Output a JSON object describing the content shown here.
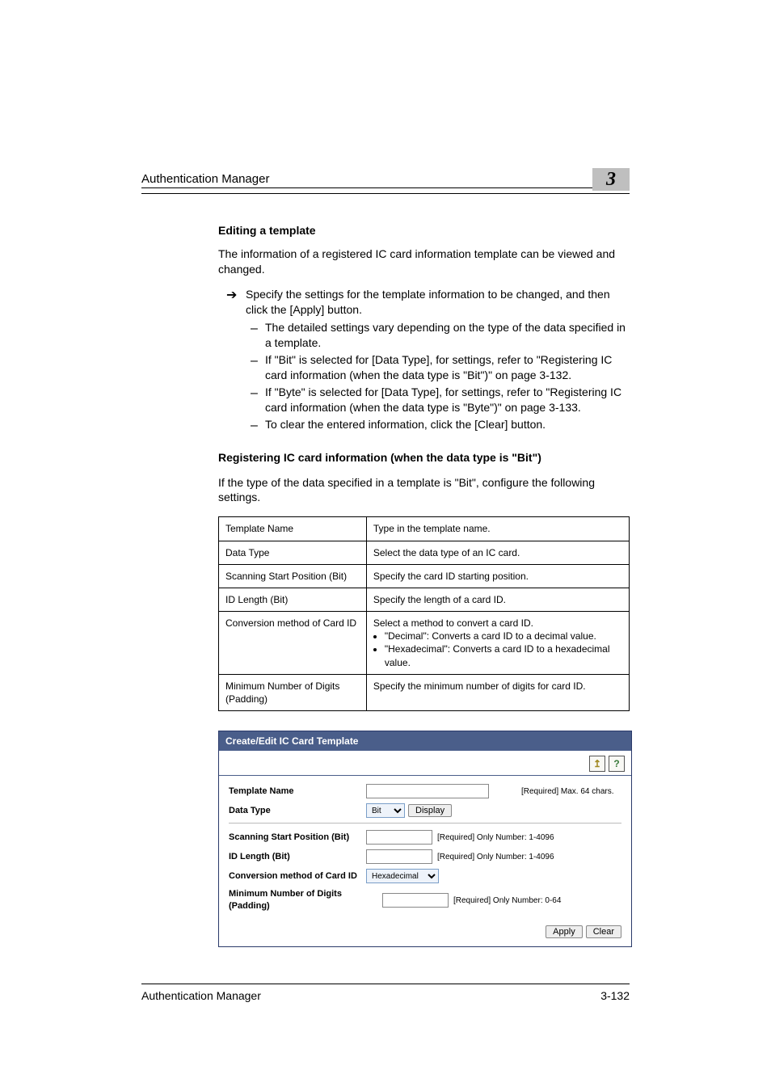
{
  "header": {
    "section": "Authentication Manager",
    "chapter": "3"
  },
  "section1": {
    "heading": "Editing a template",
    "intro": "The information of a registered IC card information template can be viewed and changed.",
    "arrow_text": "Specify the settings for the template information to be changed, and then click the [Apply] button.",
    "dashes": [
      "The detailed settings vary depending on the type of the data specified in a template.",
      "If \"Bit\" is selected for [Data Type], for settings, refer to \"Registering IC card information (when the data type is \"Bit\")\" on page 3-132.",
      "If \"Byte\" is selected for [Data Type], for settings, refer to \"Registering IC card information (when the data type is \"Byte\")\" on page 3-133.",
      "To clear the entered information, click the [Clear] button."
    ]
  },
  "section2": {
    "heading": "Registering IC card information (when the data type is \"Bit\")",
    "intro": "If the type of the data specified in a template is \"Bit\", configure the following settings."
  },
  "table": {
    "rows": [
      {
        "name": "Template Name",
        "desc": "Type in the template name."
      },
      {
        "name": "Data Type",
        "desc": "Select the data type of an IC card."
      },
      {
        "name": "Scanning Start Position (Bit)",
        "desc": "Specify the card ID starting position."
      },
      {
        "name": "ID Length (Bit)",
        "desc": "Specify the length of a card ID."
      },
      {
        "name": "Conversion method of Card ID",
        "desc": "Select a method to convert a card ID.",
        "bullets": [
          "\"Decimal\": Converts a card ID to a decimal value.",
          "\"Hexadecimal\": Converts a card ID to a hexadecimal value."
        ]
      },
      {
        "name": "Minimum Number of Digits (Padding)",
        "desc": "Specify the minimum number of digits for card ID."
      }
    ]
  },
  "fig": {
    "title": "Create/Edit IC Card Template",
    "labels": {
      "template_name": "Template Name",
      "data_type": "Data Type",
      "scan_start": "Scanning Start Position (Bit)",
      "id_length": "ID Length (Bit)",
      "conversion": "Conversion method of Card ID",
      "min_digits": "Minimum Number of Digits (Padding)"
    },
    "hints": {
      "max64": "[Required] Max. 64 chars.",
      "num1_4096": "[Required] Only Number: 1-4096",
      "num0_64": "[Required] Only Number: 0-64"
    },
    "selects": {
      "data_type_value": "Bit",
      "conversion_value": "Hexadecimal"
    },
    "buttons": {
      "display": "Display",
      "apply": "Apply",
      "clear": "Clear"
    },
    "icons": {
      "up": "↥",
      "help": "?"
    }
  },
  "footer": {
    "left": "Authentication Manager",
    "right": "3-132"
  }
}
